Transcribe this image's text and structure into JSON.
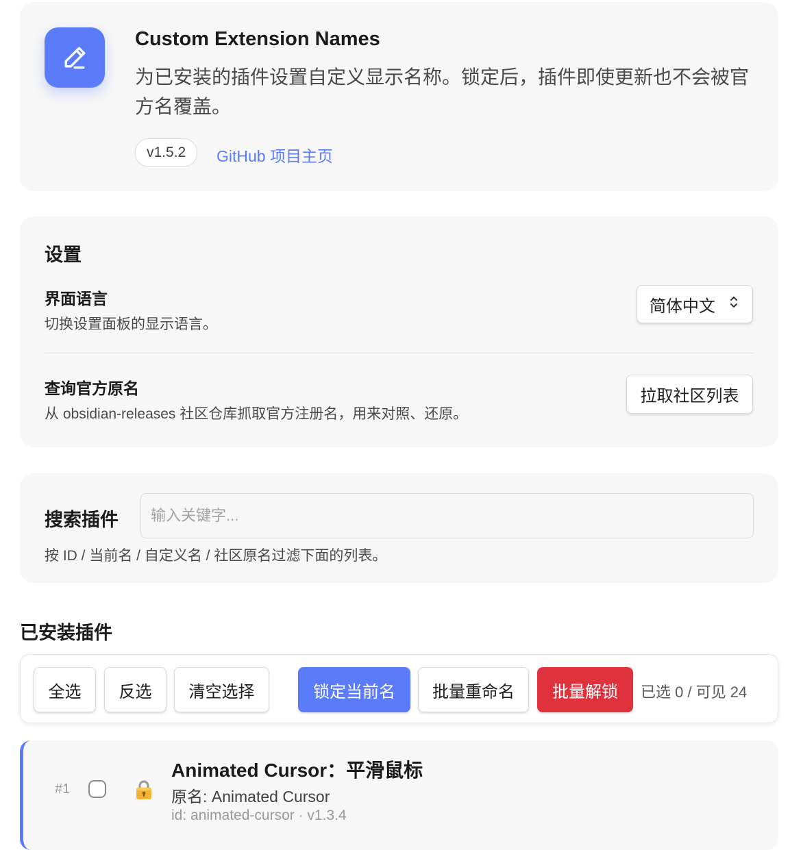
{
  "header": {
    "icon": "pencil-icon",
    "accent_color": "#5b7cfa",
    "title": "Custom Extension Names",
    "description": "为已安装的插件设置自定义显示名称。锁定后，插件即使更新也不会被官方名覆盖。",
    "version": "v1.5.2",
    "github_link": "GitHub 项目主页"
  },
  "settings": {
    "title": "设置",
    "language": {
      "name": "界面语言",
      "desc": "切换设置面板的显示语言。",
      "selected": "简体中文",
      "icon": "chevron-updown-icon"
    },
    "official": {
      "name": "查询官方原名",
      "desc": "从 obsidian-releases 社区仓库抓取官方注册名，用来对照、还原。",
      "button": "拉取社区列表"
    }
  },
  "search": {
    "label": "搜索插件",
    "placeholder": "输入关键字...",
    "hint": "按 ID / 当前名 / 自定义名 / 社区原名过滤下面的列表。"
  },
  "installed": {
    "heading": "已安装插件",
    "toolbar": {
      "select_all": "全选",
      "invert": "反选",
      "clear": "清空选择",
      "lock_current": "锁定当前名",
      "batch_rename": "批量重命名",
      "batch_unlock": "批量解锁",
      "count": "已选 0 / 可见 24"
    },
    "danger_color": "#e0323c",
    "plugins": [
      {
        "index": "#1",
        "title": "Animated Cursor：平滑鼠标",
        "original": "原名: Animated Cursor",
        "meta": "id: animated-cursor · v1.3.4",
        "locked": true,
        "icon": "lock-icon"
      }
    ]
  }
}
